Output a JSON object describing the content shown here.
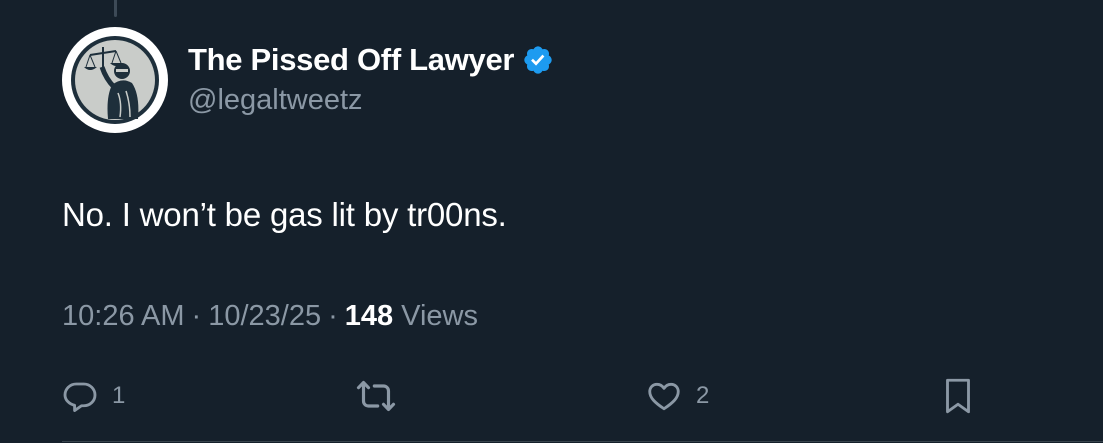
{
  "author": {
    "display_name": "The Pissed Off Lawyer",
    "handle": "@legaltweetz",
    "verified": true,
    "verified_color": "#1d9bf0",
    "avatar_icon": "lady-justice-icon"
  },
  "tweet": {
    "text": "No. I won’t be gas lit by tr00ns."
  },
  "meta": {
    "time": "10:26 AM",
    "date": "10/23/25",
    "separator": "·",
    "views_count": "148",
    "views_label": "Views"
  },
  "actions": {
    "reply_count": "1",
    "retweet_count": "",
    "like_count": "2"
  },
  "colors": {
    "background": "#15202b",
    "primary_text": "#ffffff",
    "secondary_text": "#8b98a5"
  }
}
